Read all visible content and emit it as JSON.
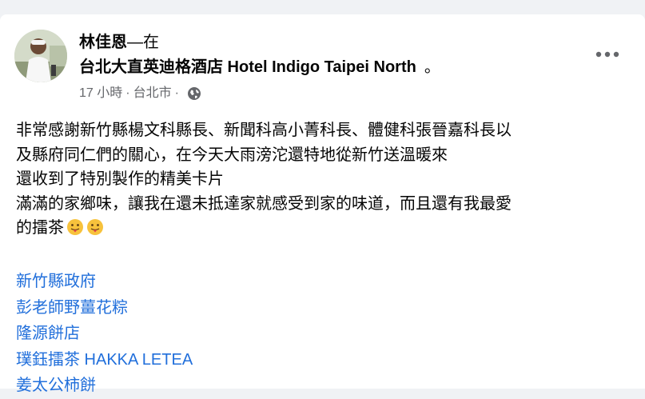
{
  "post": {
    "author": "林佳恩",
    "at_separator": "—在",
    "place": "台北大直英迪格酒店 Hotel Indigo Taipei North",
    "place_suffix": "。",
    "time": "17 小時",
    "meta_separator": "·",
    "location": "台北市",
    "meta_separator_2": "·",
    "privacy_icon": "globe-icon",
    "more_icon": "more-options-icon",
    "text_lines": [
      "非常感謝新竹縣楊文科縣長、新聞科高小菁科長、體健科張晉嘉科長以",
      "及縣府同仁們的關心，在今天大雨滂沱還特地從新竹送溫暖來",
      "還收到了特別製作的精美卡片",
      "滿滿的家鄉味，讓我在還未抵達家就感受到家的味道，而且還有我最愛",
      "的擂茶"
    ],
    "emoji": [
      "tongue-out-emoji",
      "tongue-out-emoji"
    ],
    "tags": [
      "新竹縣政府",
      "彭老師野薑花粽",
      "隆源餅店",
      "璞鈺擂茶 HAKKA LETEA",
      "姜太公柿餅"
    ]
  },
  "colors": {
    "link": "#216fdb",
    "text": "#050505",
    "secondary": "#65676b",
    "background": "#f0f2f5"
  }
}
